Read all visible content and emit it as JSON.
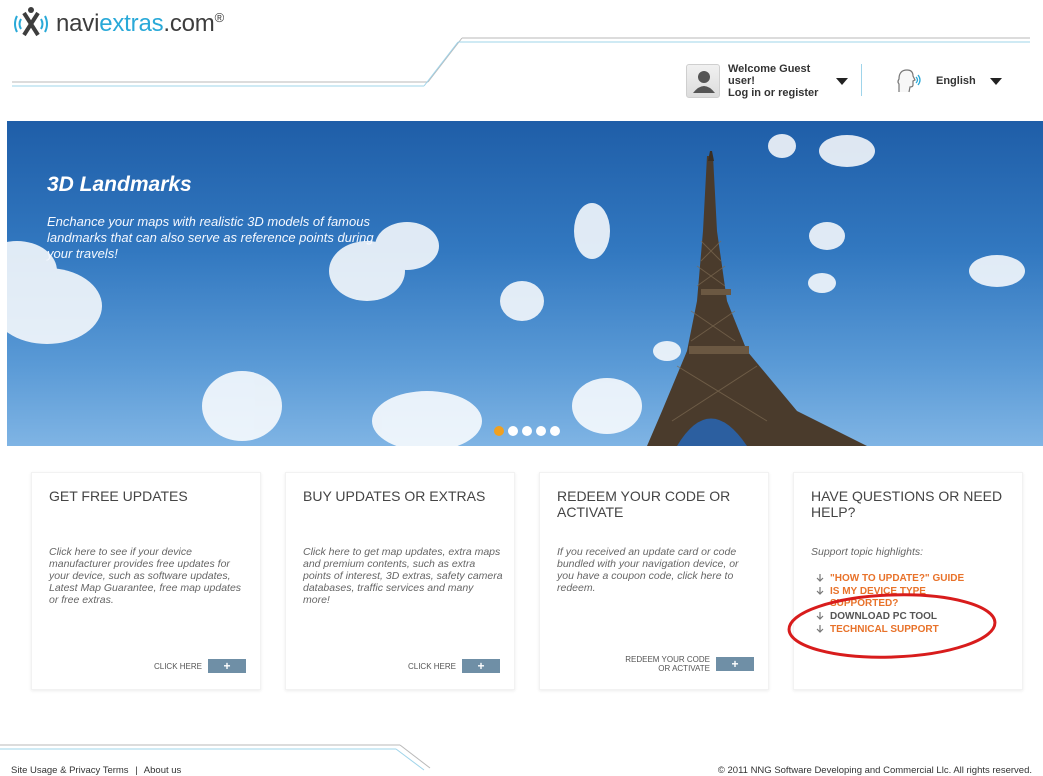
{
  "header": {
    "logo": {
      "text_main": "navi",
      "text_accent": "extras",
      "text_suffix": ".com",
      "mark": "®"
    },
    "user": {
      "greeting": "Welcome Guest user!",
      "login_link": "Log in or register",
      "icon": "user-silhouette-icon"
    },
    "language": {
      "selected": "English",
      "icon": "speaking-head-icon"
    }
  },
  "hero": {
    "title": "3D Landmarks",
    "description": "Enchance your maps with realistic 3D models of famous landmarks that can also serve as reference points during your travels!",
    "slides_total": 5,
    "active_slide": 1
  },
  "cards": [
    {
      "title": "GET FREE UPDATES",
      "body": "Click here to see if your device manufacturer provides free updates for your device, such as software updates, Latest Map Guarantee, free map updates or free extras.",
      "action_label": "CLICK HERE",
      "action_icon": "plus-icon"
    },
    {
      "title": "BUY UPDATES OR EXTRAS",
      "body": "Click here to get map updates, extra maps and premium contents, such as extra points of interest, 3D extras, safety camera databases, traffic services and many more!",
      "action_label": "CLICK HERE",
      "action_icon": "plus-icon"
    },
    {
      "title": "REDEEM YOUR CODE OR ACTIVATE",
      "body": "If you received an update card or code bundled with your navigation device, or you have a coupon code, click here to redeem.",
      "action_label": "REDEEM YOUR CODE OR ACTIVATE",
      "action_icon": "plus-icon"
    },
    {
      "title": "HAVE QUESTIONS OR NEED HELP?",
      "body": "Support topic highlights:",
      "links": [
        {
          "label": "\"HOW TO UPDATE?\" GUIDE",
          "color": "#e8722a"
        },
        {
          "label": "IS MY DEVICE TYPE SUPPORTED?",
          "color": "#e8722a"
        },
        {
          "label": "DOWNLOAD PC TOOL",
          "color": "#555555"
        },
        {
          "label": "TECHNICAL SUPPORT",
          "color": "#e8722a"
        }
      ]
    }
  ],
  "footer": {
    "links": [
      "Site Usage & Privacy Terms",
      "About us"
    ],
    "separator": "|",
    "copyright": "© 2011 NNG Software Developing and Commercial Llc. All rights reserved."
  },
  "colors": {
    "accent_blue": "#29a9d8",
    "link_orange": "#e8722a",
    "button_blue_gray": "#6f8fa6",
    "annotation_red": "#d81c1c",
    "slider_active": "#f0a020"
  }
}
